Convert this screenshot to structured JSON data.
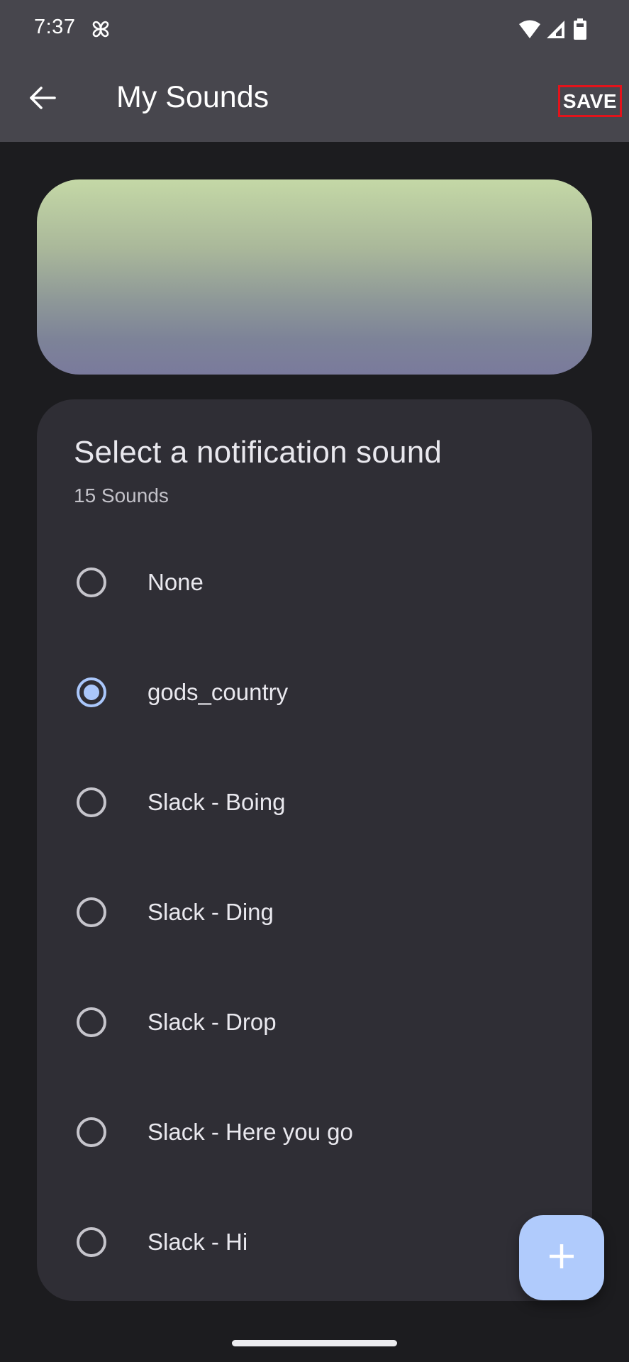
{
  "status_bar": {
    "time": "7:37",
    "icons": [
      "pinwheel-icon",
      "wifi-icon",
      "cellular-signal-icon",
      "battery-icon"
    ]
  },
  "app_bar": {
    "back_icon": "arrow-left-icon",
    "title": "My Sounds",
    "save_label": "SAVE"
  },
  "banner": {
    "gradient_top": "#c4d8a6",
    "gradient_bottom": "#7a7a9c"
  },
  "card": {
    "title": "Select a notification sound",
    "subtitle": "15 Sounds",
    "sounds": [
      {
        "label": "None",
        "selected": false
      },
      {
        "label": "gods_country",
        "selected": true
      },
      {
        "label": "Slack - Boing",
        "selected": false
      },
      {
        "label": "Slack - Ding",
        "selected": false
      },
      {
        "label": "Slack - Drop",
        "selected": false
      },
      {
        "label": "Slack - Here you go",
        "selected": false
      },
      {
        "label": "Slack - Hi",
        "selected": false
      }
    ]
  },
  "fab": {
    "icon": "plus-icon",
    "color": "#b0cbfc"
  },
  "colors": {
    "accent": "#aac7fb",
    "app_bar": "#47464d",
    "background": "#1c1c1f",
    "card": "#2f2e35",
    "highlight_box": "#e3131b"
  }
}
